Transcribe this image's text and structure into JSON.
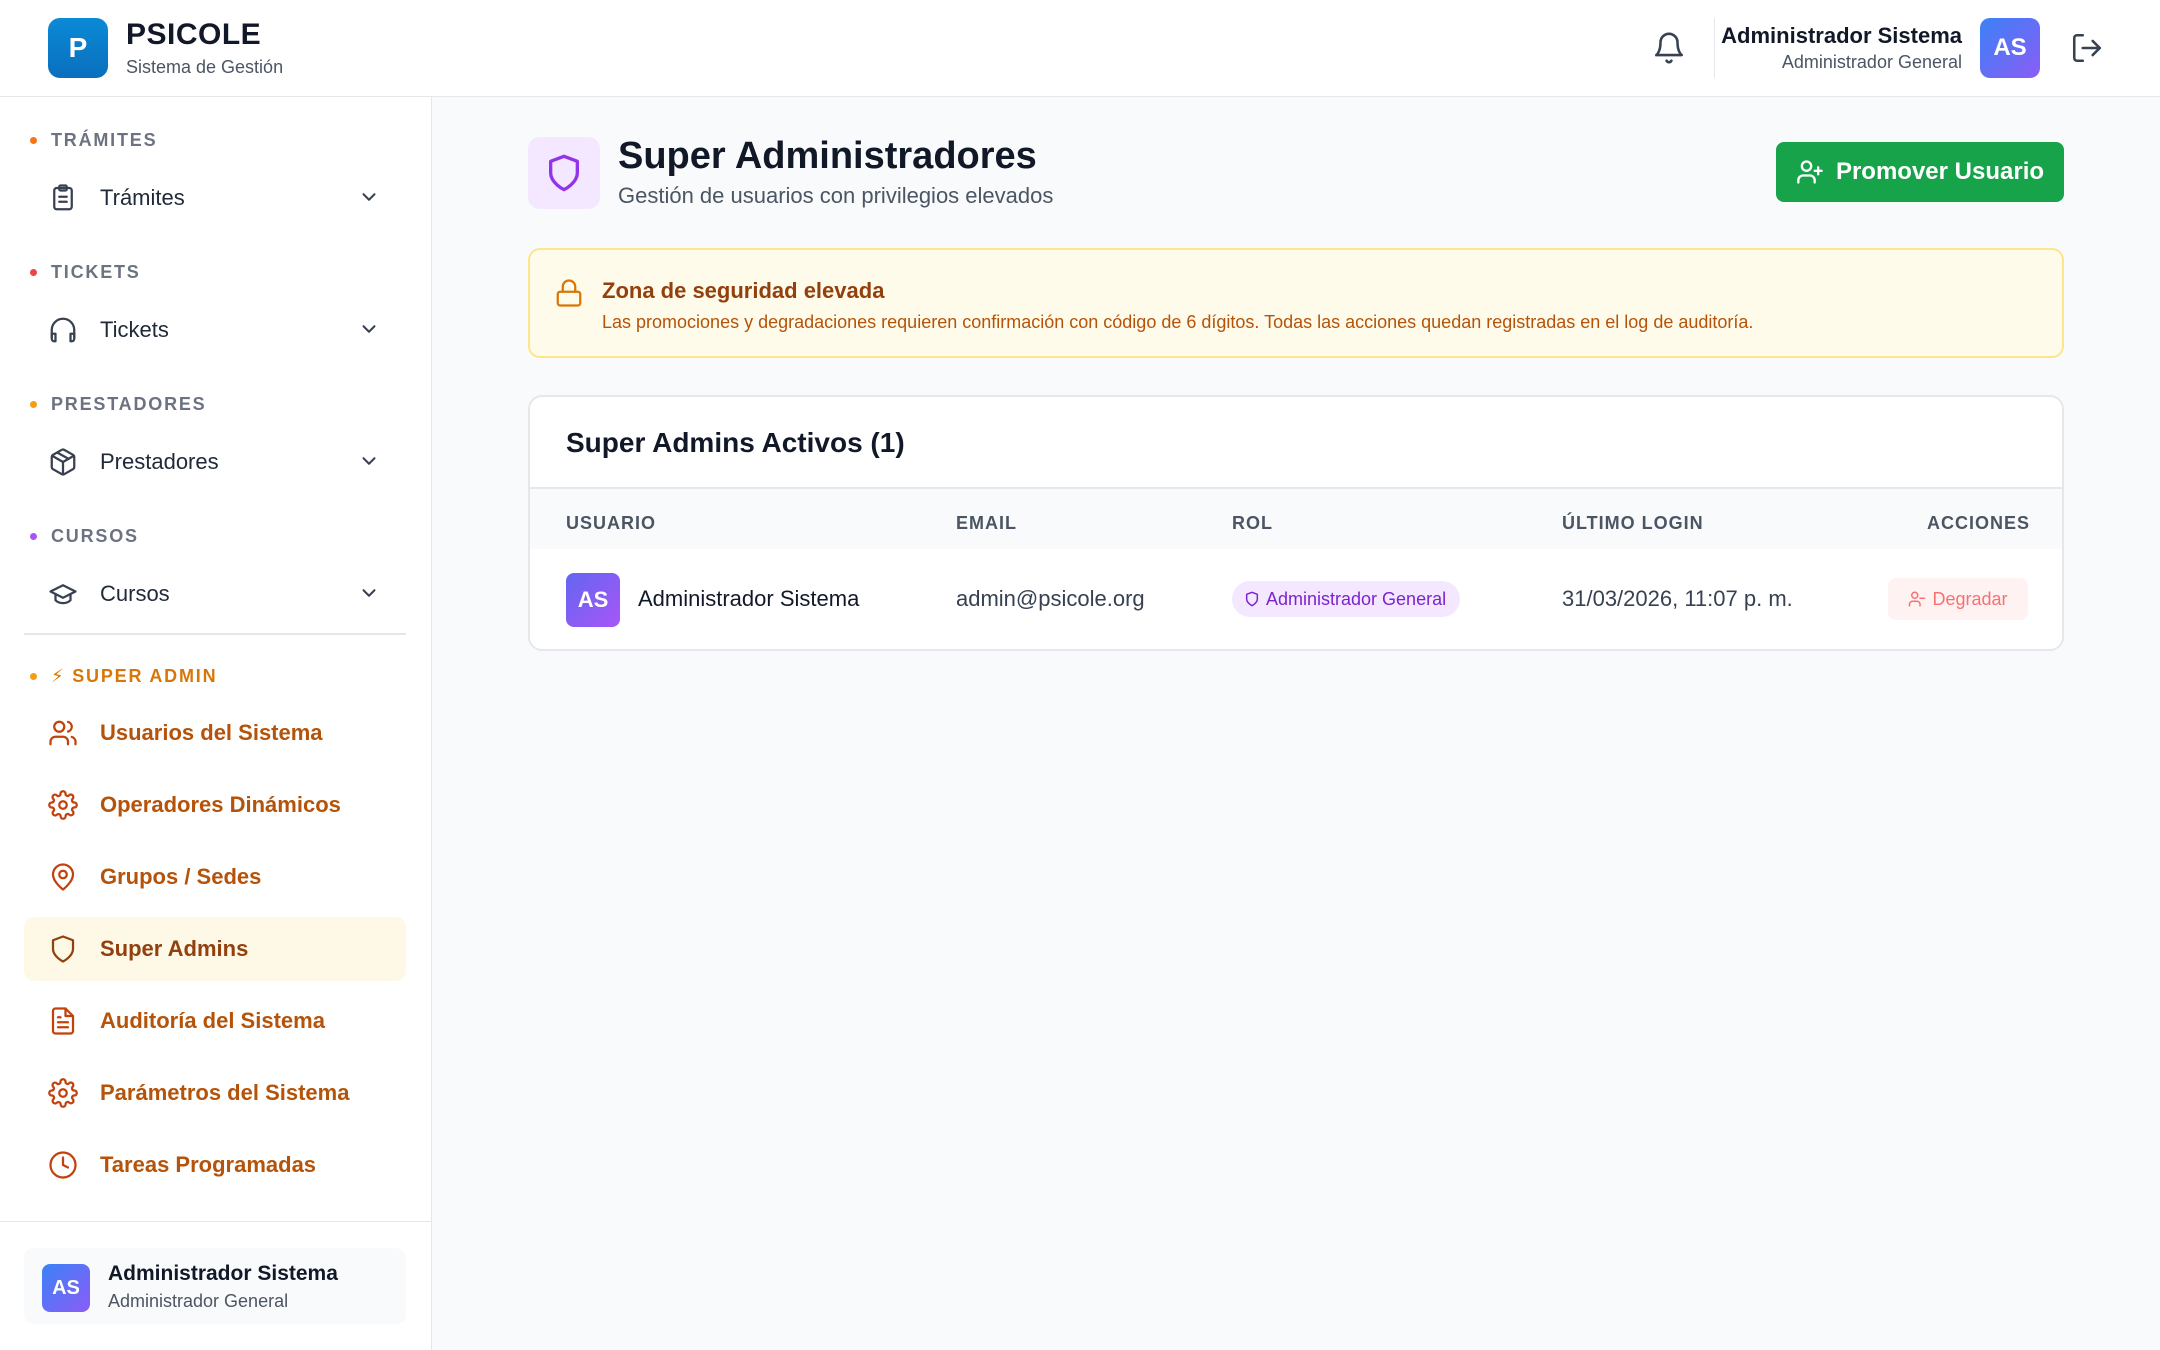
{
  "header": {
    "logo_letter": "P",
    "brand_name": "PSICOLE",
    "brand_sub": "Sistema de Gestión",
    "user_name": "Administrador Sistema",
    "user_role": "Administrador General",
    "avatar_initials": "AS"
  },
  "sidebar": {
    "sections": [
      {
        "title": "TRÁMITES",
        "dot_color": "#f97316",
        "item": "Trámites",
        "icon": "clipboard-icon"
      },
      {
        "title": "TICKETS",
        "dot_color": "#ef4444",
        "item": "Tickets",
        "icon": "headphones-icon"
      },
      {
        "title": "PRESTADORES",
        "dot_color": "#f59e0b",
        "item": "Prestadores",
        "icon": "package-icon"
      },
      {
        "title": "CURSOS",
        "dot_color": "#a855f7",
        "item": "Cursos",
        "icon": "graduation-cap-icon"
      }
    ],
    "super_admin": {
      "title": "⚡ SUPER ADMIN",
      "dot_color": "#f59e0b",
      "items": [
        {
          "label": "Usuarios del Sistema",
          "icon": "users-icon"
        },
        {
          "label": "Operadores Dinámicos",
          "icon": "gear-icon"
        },
        {
          "label": "Grupos / Sedes",
          "icon": "map-pin-icon"
        },
        {
          "label": "Super Admins",
          "icon": "shield-icon",
          "active": true
        },
        {
          "label": "Auditoría del Sistema",
          "icon": "file-text-icon"
        },
        {
          "label": "Parámetros del Sistema",
          "icon": "gear-icon"
        },
        {
          "label": "Tareas Programadas",
          "icon": "clock-icon"
        }
      ]
    },
    "user": {
      "initials": "AS",
      "name": "Administrador Sistema",
      "role": "Administrador General"
    }
  },
  "main": {
    "title": "Super Administradores",
    "subtitle": "Gestión de usuarios con privilegios elevados",
    "promote_label": "Promover Usuario",
    "warning": {
      "title": "Zona de seguridad elevada",
      "text": "Las promociones y degradaciones requieren confirmación con código de 6 dígitos. Todas las acciones quedan registradas en el log de auditoría."
    },
    "table": {
      "title": "Super Admins Activos (1)",
      "columns": [
        "USUARIO",
        "EMAIL",
        "ROL",
        "ÚLTIMO LOGIN",
        "ACCIONES"
      ],
      "rows": [
        {
          "initials": "AS",
          "name": "Administrador Sistema",
          "email": "admin@psicole.org",
          "role": "Administrador General",
          "last_login": "31/03/2026, 11:07 p. m.",
          "action": "Degradar"
        }
      ]
    }
  },
  "colors": {
    "accent_green": "#16a34a",
    "admin_orange": "#b45309",
    "role_purple": "#7e22ce",
    "warning_bg": "#fefbea"
  }
}
